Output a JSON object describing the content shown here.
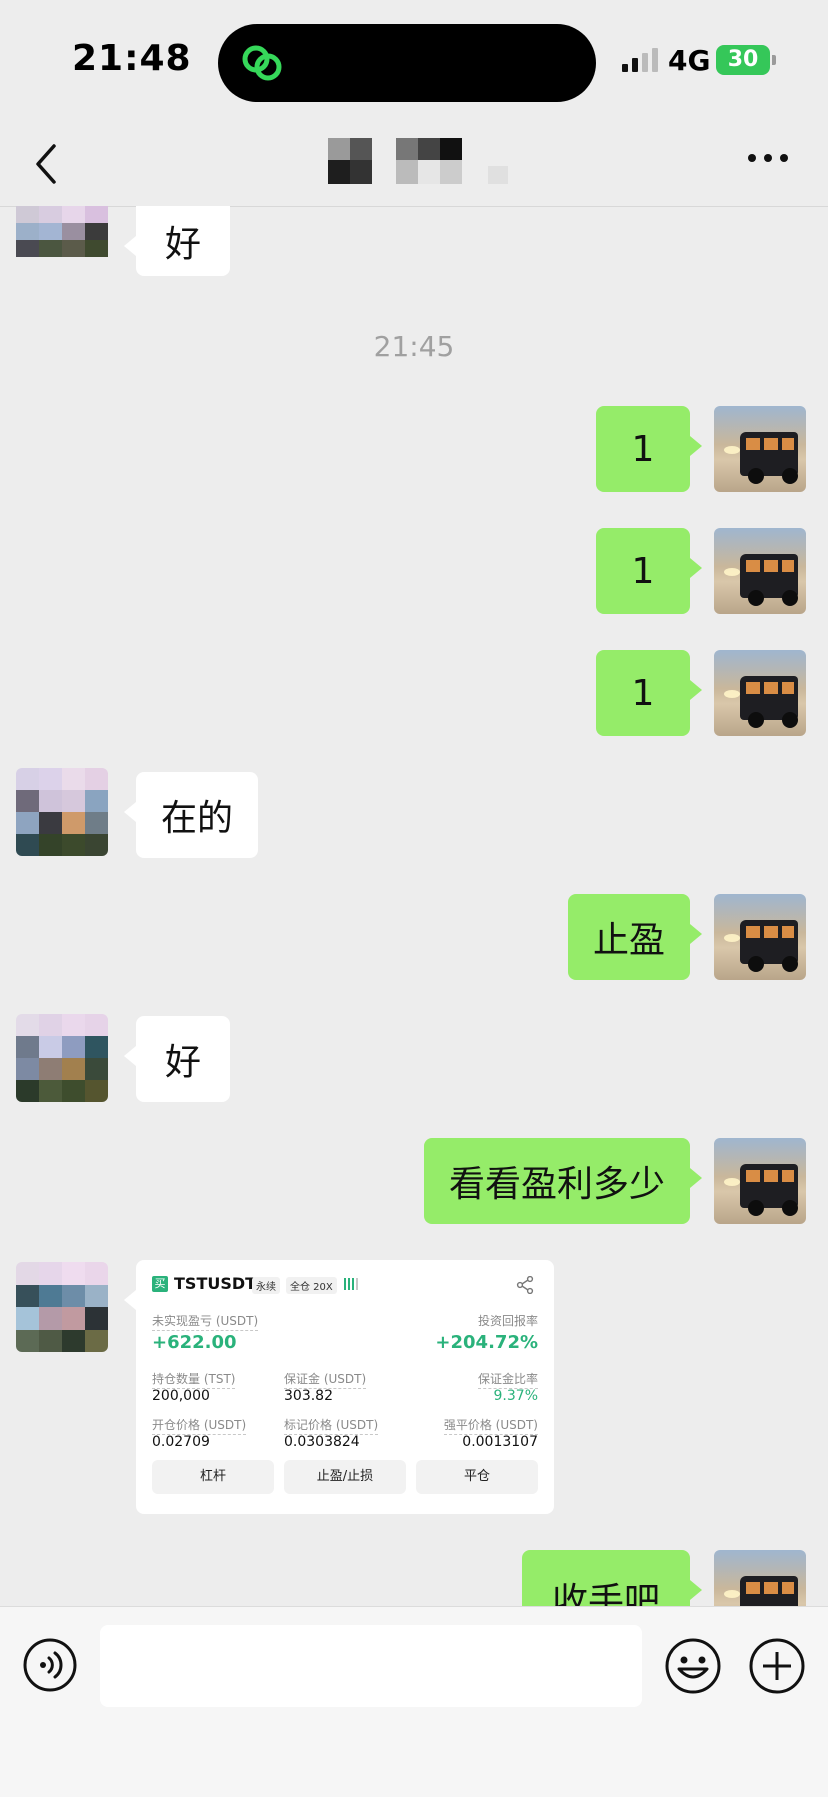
{
  "status_bar": {
    "time": "21:48",
    "network": "4G",
    "battery": "30"
  },
  "header": {
    "title": ""
  },
  "messages": {
    "m1": "好",
    "timestamp": "21:45",
    "m2": "1",
    "m3": "1",
    "m4": "1",
    "m5": "在的",
    "m6": "止盈",
    "m7": "好",
    "m8": "看看盈利多少",
    "m10": "收手吧"
  },
  "trade_card": {
    "side_badge": "买",
    "symbol": "TSTUSDT",
    "contract_type": "永续",
    "margin_mode": "全仓 20X",
    "unrealized_pnl_label": "未实现盈亏 (USDT)",
    "unrealized_pnl": "+622.00",
    "roi_label": "投资回报率",
    "roi": "+204.72%",
    "position_size_label": "持仓数量 (TST)",
    "position_size": "200,000",
    "margin_label": "保证金 (USDT)",
    "margin": "303.82",
    "margin_ratio_label": "保证金比率",
    "margin_ratio": "9.37%",
    "entry_price_label": "开仓价格 (USDT)",
    "entry_price": "0.02709",
    "mark_price_label": "标记价格 (USDT)",
    "mark_price": "0.0303824",
    "liq_price_label": "强平价格 (USDT)",
    "liq_price": "0.0013107",
    "btn_leverage": "杠杆",
    "btn_tpsl": "止盈/止损",
    "btn_close": "平仓"
  },
  "colors": {
    "outgoing_bubble": "#95ec69",
    "profit_green": "#2ab27b",
    "background": "#ededed"
  },
  "icons": {
    "back": "chevron-left-icon",
    "more": "more-dots-icon",
    "voice": "voice-icon",
    "emoji": "emoji-icon",
    "plus": "plus-icon",
    "share": "share-icon",
    "island_app": "link-icon"
  }
}
